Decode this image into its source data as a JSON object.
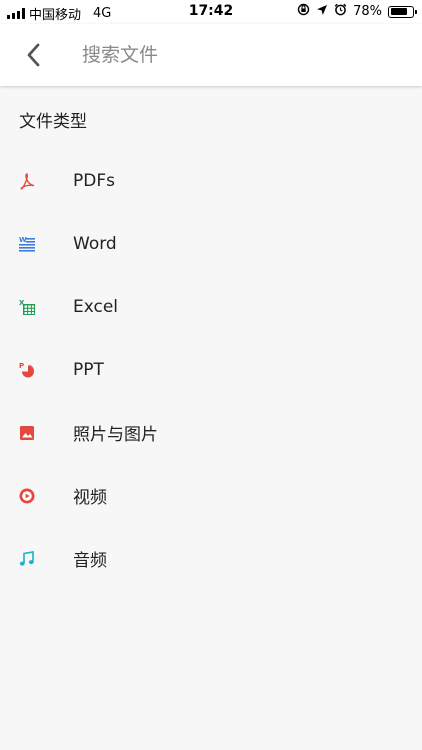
{
  "status_bar": {
    "carrier": "中国移动",
    "network": "4G",
    "time": "17:42",
    "battery": "78%",
    "battery_level": 0.78
  },
  "app_bar": {
    "search_placeholder": "搜索文件",
    "back_icon": "chevron-left-icon"
  },
  "section": {
    "title": "文件类型"
  },
  "file_types": [
    {
      "label": "PDFs",
      "icon": "pdf-icon",
      "color": "#e5483d"
    },
    {
      "label": "Word",
      "icon": "word-icon",
      "color": "#3b7ddd"
    },
    {
      "label": "Excel",
      "icon": "excel-icon",
      "color": "#1f9d55"
    },
    {
      "label": "PPT",
      "icon": "ppt-icon",
      "color": "#e5483d"
    },
    {
      "label": "照片与图片",
      "icon": "image-icon",
      "color": "#e5483d"
    },
    {
      "label": "视频",
      "icon": "video-icon",
      "color": "#e5483d"
    },
    {
      "label": "音频",
      "icon": "audio-icon",
      "color": "#1ab4c5"
    }
  ]
}
